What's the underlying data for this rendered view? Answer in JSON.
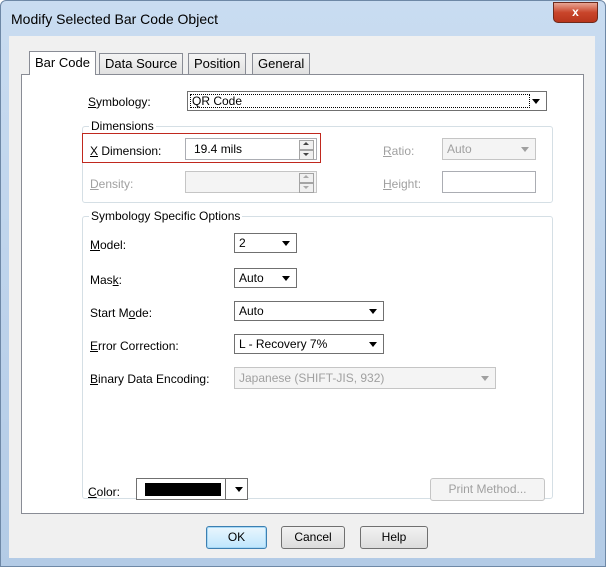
{
  "window": {
    "title": "Modify Selected Bar Code Object",
    "close_glyph": "x"
  },
  "tabs": [
    {
      "label": "Bar Code",
      "active": true
    },
    {
      "label": "Data Source",
      "active": false
    },
    {
      "label": "Position",
      "active": false
    },
    {
      "label": "General",
      "active": false
    }
  ],
  "symbology": {
    "label": "Symbology:",
    "value": "QR Code"
  },
  "dimensions": {
    "group_title": "Dimensions",
    "x_dimension": {
      "label": "X Dimension:",
      "value": "19.4 mils"
    },
    "ratio": {
      "label": "Ratio:",
      "value": "Auto"
    },
    "density": {
      "label": "Density:",
      "value": ""
    },
    "height": {
      "label": "Height:",
      "value": ""
    }
  },
  "options": {
    "group_title": "Symbology Specific Options",
    "model": {
      "label": "Model:",
      "value": "2"
    },
    "mask": {
      "label": "Mask:",
      "value": "Auto"
    },
    "start_mode": {
      "label": "Start Mode:",
      "value": "Auto"
    },
    "error_correction": {
      "label": "Error Correction:",
      "value": "L - Recovery 7%"
    },
    "binary_encoding": {
      "label": "Binary Data Encoding:",
      "value": "Japanese (SHIFT-JIS, 932)"
    }
  },
  "color": {
    "label": "Color:",
    "value": "#000000"
  },
  "buttons": {
    "print_method": "Print Method...",
    "ok": "OK",
    "cancel": "Cancel",
    "help": "Help"
  },
  "colors": {
    "highlight": "#c0281e",
    "close_button": "#c9452b"
  }
}
